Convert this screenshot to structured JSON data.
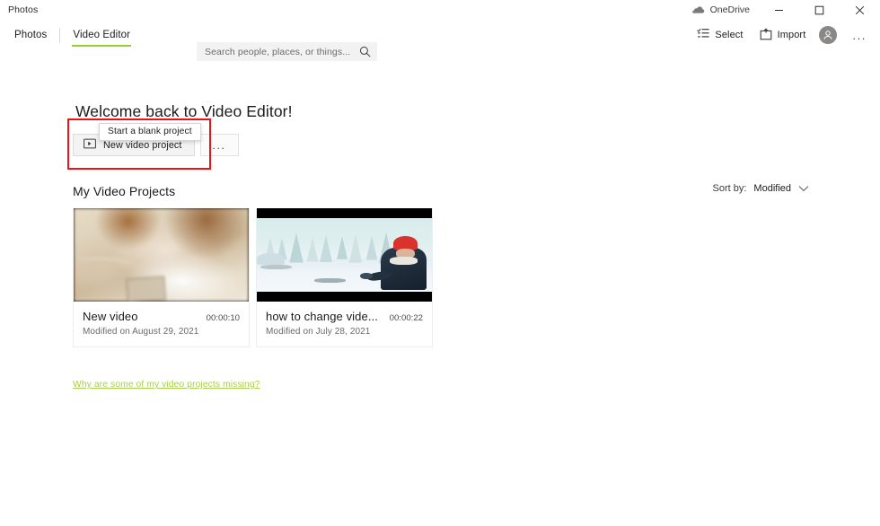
{
  "titlebar": {
    "app_name": "Photos",
    "onedrive_label": "OneDrive",
    "minimize_label": "Minimize",
    "maximize_label": "Maximize",
    "close_label": "Close"
  },
  "commandbar": {
    "tabs": [
      {
        "label": "Photos",
        "active": false
      },
      {
        "label": "Video Editor",
        "active": true
      }
    ],
    "search": {
      "placeholder": "Search people, places, or things...",
      "value": ""
    },
    "actions": [
      {
        "label": "Select",
        "icon": "select-icon"
      },
      {
        "label": "Import",
        "icon": "import-icon"
      }
    ],
    "account_label": "Account",
    "more_label": "..."
  },
  "main": {
    "welcome_title": "Welcome back to Video Editor!",
    "new_project_button": "New video project",
    "new_project_more": "...",
    "tooltip": "Start a blank project",
    "section_title": "My Video Projects",
    "sort": {
      "label": "Sort by:",
      "value": "Modified"
    },
    "projects": [
      {
        "name": "New video",
        "duration": "00:00:10",
        "modified": "Modified on August 29, 2021",
        "thumbnail": "blurred-cat-photo"
      },
      {
        "name": "how to change vide...",
        "duration": "00:00:22",
        "modified": "Modified on July 28, 2021",
        "thumbnail": "winter-scene-person-red-hat"
      }
    ],
    "missing_link": "Why are some of my video projects missing?"
  },
  "colors": {
    "accent_green": "#9acd32",
    "link_green": "#a8d14a",
    "highlight_red": "#ee1111",
    "button_face": "#f3f3f3",
    "search_bg": "#f2f2f2"
  }
}
